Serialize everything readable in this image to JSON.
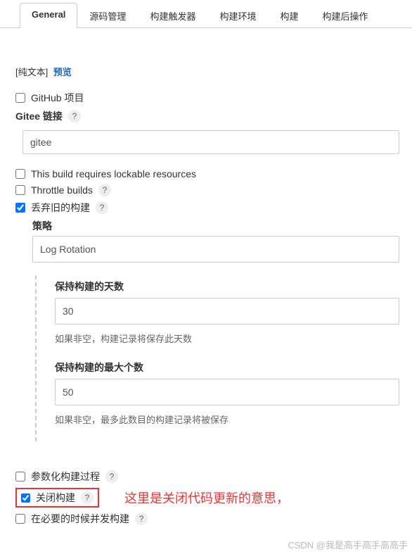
{
  "tabs": {
    "general": "General",
    "scm": "源码管理",
    "triggers": "构建触发器",
    "env": "构建环境",
    "build": "构建",
    "post": "构建后操作"
  },
  "format": {
    "plain": "[纯文本]",
    "preview": "预览"
  },
  "options": {
    "github_project": "GitHub 项目",
    "gitee_link": "Gitee 链接",
    "gitee_value": "gitee",
    "lockable": "This build requires lockable resources",
    "throttle": "Throttle builds",
    "discard": "丢弃旧的构建",
    "strategy": "策略",
    "strategy_value": "Log Rotation",
    "keep_days_label": "保持构建的天数",
    "keep_days_value": "30",
    "keep_days_hint": "如果非空，构建记录将保存此天数",
    "keep_max_label": "保持构建的最大个数",
    "keep_max_value": "50",
    "keep_max_hint": "如果非空，最多此数目的构建记录将被保存",
    "parameterized": "参数化构建过程",
    "disable_build": "关闭构建",
    "concurrent": "在必要的时候并发构建"
  },
  "annotation": "这里是关闭代码更新的意思，",
  "watermark": "CSDN @我是高手高手高高手"
}
